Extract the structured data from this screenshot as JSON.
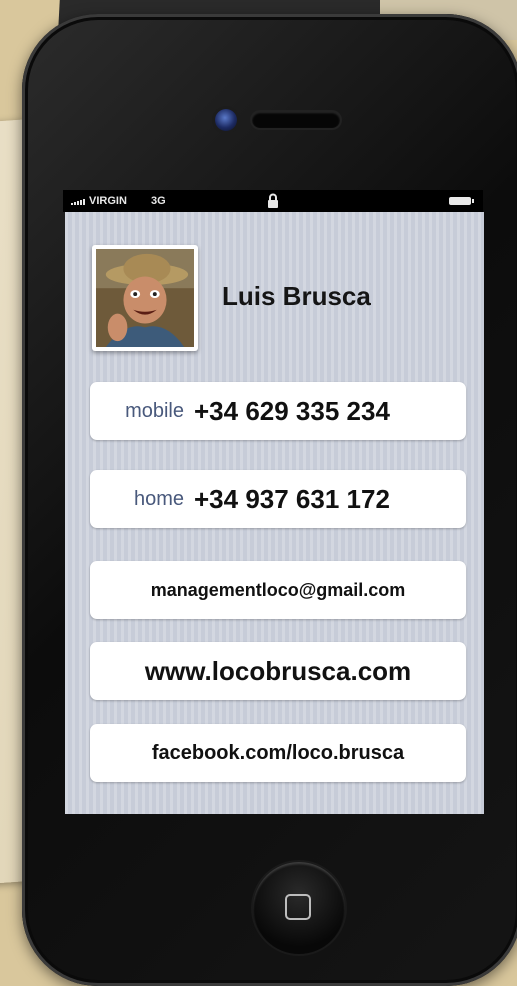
{
  "status_bar": {
    "carrier": "VIRGIN",
    "network": "3G"
  },
  "contact": {
    "name": "Luis Brusca"
  },
  "fields": {
    "mobile": {
      "label": "mobile",
      "value": "+34 629 335 234"
    },
    "home": {
      "label": "home",
      "value": "+34 937 631 172"
    },
    "email": "managementloco@gmail.com",
    "website": "www.locobrusca.com",
    "facebook": "facebook.com/loco.brusca"
  },
  "icons": [
    "signal-icon",
    "lock-icon",
    "battery-icon",
    "camera-icon",
    "speaker-icon",
    "home-button-icon"
  ],
  "colors": {
    "label": "#49597c",
    "screen_bg": "#c7ccd8",
    "phone_body": "#111111"
  }
}
